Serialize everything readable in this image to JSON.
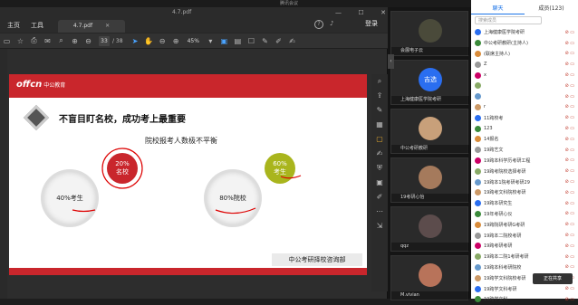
{
  "meeting": {
    "title": "腾讯会议"
  },
  "pdf": {
    "filename": "4.7.pdf",
    "menu": [
      "主页",
      "工具"
    ],
    "tab_label": "4.7.pdf",
    "login_label": "登录",
    "current_page": "33",
    "total_pages": "/ 38",
    "zoom": "45%"
  },
  "slide": {
    "logo": "offcn",
    "brand": "中公教育",
    "headline": "不盲目盯名校，成功考上最重要",
    "subtitle": "院校报考人数极不平衡",
    "circle1_label": "40%考生",
    "badge1_line1": "20%",
    "badge1_line2": "名校",
    "circle2_label": "80%院校",
    "badge2_line1": "60%",
    "badge2_line2": "考生",
    "footer": "中公考研择校咨询部",
    "badge1_color": "#c9262c",
    "badge2_color": "#a9b51d"
  },
  "participants": [
    {
      "name": "会展电子云"
    },
    {
      "name": "上海健康医学院考研",
      "avatar_text": "吉选"
    },
    {
      "name": "中公考研教研"
    },
    {
      "name": "19考研心怡"
    },
    {
      "name": "qqz"
    },
    {
      "name": "M.vivian"
    }
  ],
  "chat": {
    "tab_chat": "聊天",
    "tab_members": "成员(123)",
    "search_placeholder": "搜索成员",
    "float_button": "正在共享",
    "rows": [
      {
        "name": "上海健康医学院考研"
      },
      {
        "name": "中公考研教研(主持人)"
      },
      {
        "name": "(联席主持人)"
      },
      {
        "name": "Z"
      },
      {
        "name": "x"
      },
      {
        "name": ""
      },
      {
        "name": ""
      },
      {
        "name": "r"
      },
      {
        "name": "11跨校考"
      },
      {
        "name": "123"
      },
      {
        "name": "14报名"
      },
      {
        "name": "19跨艺文"
      },
      {
        "name": "19跨本科学历考研工程"
      },
      {
        "name": "19跨考院校选择考研"
      },
      {
        "name": "19跨本1院考研考研29"
      },
      {
        "name": "19跨考文科院校考研"
      },
      {
        "name": "19跨本研究生"
      },
      {
        "name": "19年考研心仪"
      },
      {
        "name": "19跨院研考研G考研"
      },
      {
        "name": "19跨本二院校考研"
      },
      {
        "name": "19跨考研考研"
      },
      {
        "name": "19跨本二院1考研考研"
      },
      {
        "name": "19跨本科考研院校"
      },
      {
        "name": "19跨学文科院校考研"
      },
      {
        "name": "19跨学文科考研"
      },
      {
        "name": "19跨学文科"
      }
    ]
  }
}
